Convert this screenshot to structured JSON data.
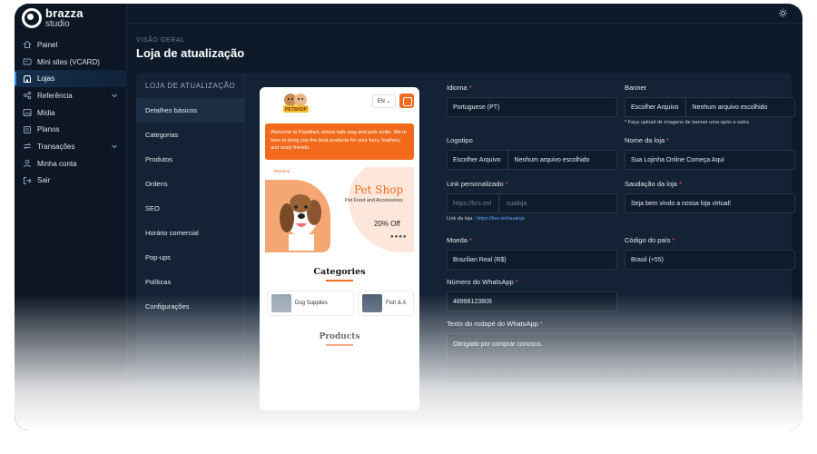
{
  "brand": {
    "name": "brazza",
    "sub": "studio"
  },
  "sidebar": {
    "items": [
      {
        "label": "Painel",
        "icon": "home-icon"
      },
      {
        "label": "Mini sites (VCARD)",
        "icon": "card-icon"
      },
      {
        "label": "Lojas",
        "icon": "store-icon",
        "active": true
      },
      {
        "label": "Referência",
        "icon": "share-icon",
        "has_chevron": true
      },
      {
        "label": "Mídia",
        "icon": "image-icon"
      },
      {
        "label": "Planos",
        "icon": "plans-icon"
      },
      {
        "label": "Transações",
        "icon": "transactions-icon",
        "has_chevron": true
      },
      {
        "label": "Minha conta",
        "icon": "user-icon"
      },
      {
        "label": "Sair",
        "icon": "logout-icon"
      }
    ]
  },
  "header": {
    "breadcrumb": "VISÃO GERAL",
    "title": "Loja de atualização"
  },
  "subnav": {
    "heading": "LOJA DE ATUALIZAÇÃO",
    "items": [
      "Detalhes básicos",
      "Categorias",
      "Produtos",
      "Ordens",
      "SEO",
      "Horário comercial",
      "Pop-ups",
      "Políticas",
      "Configurações"
    ]
  },
  "preview": {
    "logo_text": "PETSHOP",
    "lang": "EN",
    "welcome": "Welcome to PawMart, where tails wag and pets smile. We're here to bring you the best products for your furry, feathery, and scaly friends.",
    "banner_small": "PetShop",
    "banner_title": "Pet Shop",
    "banner_sub": "Pet Food and Accessories",
    "banner_offer": "20% Off",
    "banner_dots": "●●●●",
    "categories_title": "Categories",
    "categories": [
      "Dog Supplies",
      "Fish & A"
    ],
    "products_title": "Products"
  },
  "form": {
    "idioma": {
      "label": "Idioma",
      "value": "Portuguese (PT)"
    },
    "banner": {
      "label": "Banner",
      "button": "Escolher Arquivo",
      "file": "Nenhum arquivo escolhido",
      "hint": "* Faça upload de imagens de banner uma após a outra"
    },
    "logotipo": {
      "label": "Logotipo",
      "button": "Escolher Arquivo",
      "file": "Nenhum arquivo escolhido"
    },
    "nome_loja": {
      "label": "Nome da loja",
      "value": "Sua Lojinha Online Começa Aqui"
    },
    "link": {
      "label": "Link personalizado",
      "prefix": "https://brs.onl",
      "value": "sualoja",
      "hint_label": "Link da loja :",
      "hint_link": "https://brs.onl/sualoja"
    },
    "saudacao": {
      "label": "Saudação da loja",
      "value": "Seja bem vindo a nossa loja virtual!"
    },
    "moeda": {
      "label": "Moeda",
      "value": "Brazilian Real (R$)"
    },
    "codigo_pais": {
      "label": "Código do país",
      "value": "Brasil (+55)"
    },
    "whatsapp": {
      "label": "Número do WhatsApp",
      "value": "48998123809"
    },
    "rodape": {
      "label": "Texto do rodapé do WhatsApp",
      "value": "Obrigado por comprar conosco."
    }
  },
  "colors": {
    "accent": "#2f8cff",
    "brand_orange": "#f26b1d",
    "bg": "#0e1a29"
  }
}
